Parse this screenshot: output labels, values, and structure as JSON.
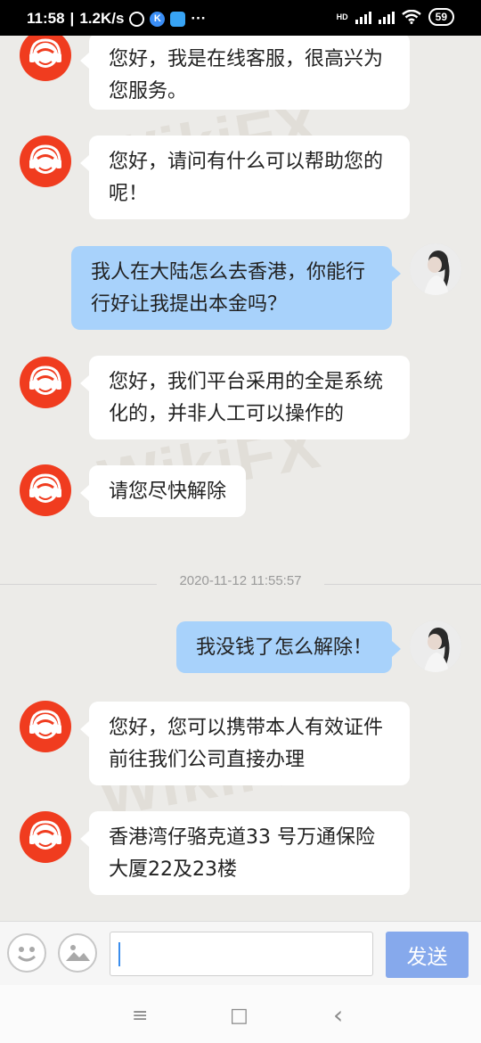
{
  "status_bar": {
    "time": "11:58",
    "speed": "1.2K/s",
    "dots": "···",
    "hd": "HD",
    "battery": "59"
  },
  "messages": [
    {
      "side": "in",
      "text": "您好，我是在线客服，很高兴为您服务。"
    },
    {
      "side": "in",
      "text": "您好，请问有什么可以帮助您的呢！"
    },
    {
      "side": "out",
      "text": "我人在大陆怎么去香港，你能行行好让我提出本金吗？"
    },
    {
      "side": "in",
      "text": "您好，我们平台采用的全是系统化的，并非人工可以操作的"
    },
    {
      "side": "in",
      "text": "请您尽快解除"
    },
    {
      "side": "out",
      "text": "我没钱了怎么解除！"
    },
    {
      "side": "in",
      "text": "您好，您可以携带本人有效证件前往我们公司直接办理"
    },
    {
      "side": "in",
      "text": "香港湾仔骆克道33 号万通保险大厦22及23楼"
    }
  ],
  "timestamp": "2020-11-12 11:55:57",
  "watermark": "WikiFX",
  "input": {
    "placeholder": "",
    "send_label": "发送"
  },
  "icons": {
    "emoji": "emoji-icon",
    "image": "image-icon",
    "menu": "≡",
    "home": "□",
    "back": "‹"
  },
  "colors": {
    "cs_avatar": "#f03c1f",
    "outgoing_bubble": "#a8d2fb",
    "send_button": "#86a9ec",
    "background": "#ecebe8"
  }
}
